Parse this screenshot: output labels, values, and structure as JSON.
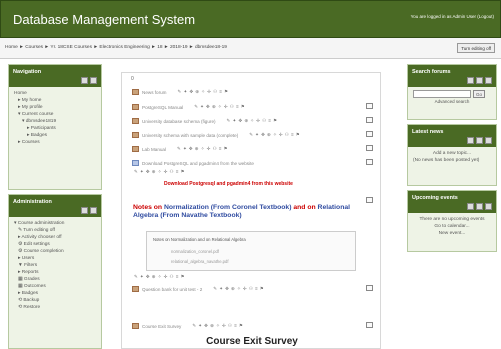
{
  "header": {
    "title": "Database Management System",
    "login_info": "You are logged in as Admin User (Logout)"
  },
  "navbar": {
    "breadcrumb": "Home ► Courses ► Yr. 18CSE Courses ► Electronics Engineering ► 18 ► 2018-19 ► dbmsdee18-19",
    "edit_button": "Turn editing off"
  },
  "navigation": {
    "title": "Navigation",
    "items": [
      "Home",
      "▸ My home",
      "▸ My profile",
      "▾ Current course",
      "▾ dbmsdee1819",
      "▸ Participants",
      "▸ Badges",
      "▸ Courses"
    ]
  },
  "administration": {
    "title": "Administration",
    "items": [
      "▾ Course administration",
      "✎ Turn editing off",
      "▸ Activity chooser off",
      "⚙ Edit settings",
      "⚙ Course completion",
      "▸ Users",
      "▼ Filters",
      "▸ Reports",
      "▦ Grades",
      "▦ Outcomes",
      "▸ Badges",
      "⟲ Backup",
      "⟲ Restore"
    ]
  },
  "search_forums": {
    "title": "Search forums",
    "go_button": "Go",
    "advanced": "Advanced search"
  },
  "latest_news": {
    "title": "Latest news",
    "add_topic": "Add a new topic...",
    "no_news": "(No news has been posted yet)"
  },
  "upcoming_events": {
    "title": "Upcoming events",
    "no_events": "There are no upcoming events",
    "go_to_calendar": "Go to calendar...",
    "new_event": "New event..."
  },
  "main": {
    "top_marker": "0",
    "activities": [
      "News forum",
      "PostgreSQL Manual",
      "University database schema (figure)",
      "University schema with sample data (complete)",
      "Lab Manual",
      "Download PostgreSQL and pgadmin4 from the website"
    ],
    "edit_icons": "✎ ✦ ✥ ⊕ ✧ ✢ ⚇ ≡ ⚑",
    "red_link": "Download Postgresql and pgadmin4 from this website",
    "notes_text_1": "Notes on",
    "notes_text_2": "Normalization (From Coronel Textbook)",
    "notes_text_3": "and on",
    "notes_text_4": "Relational Algebra (From Navathe Textbook)",
    "sublist_title": "Notes on Normalization and on Relational Algebra",
    "sublist_items": [
      "normalization_coronel.pdf",
      "relational_algebra_navathe.pdf"
    ],
    "question_bank": "Question bank for unit test - 2",
    "exit_item": "Course Exit Survey",
    "exit_title": "Course Exit Survey"
  }
}
